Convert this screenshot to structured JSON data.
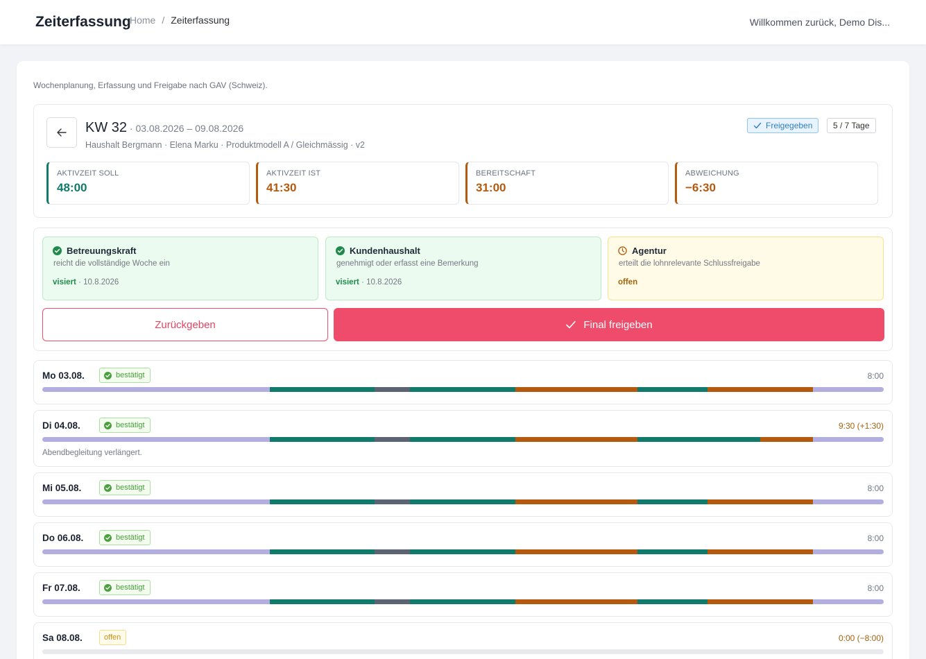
{
  "header": {
    "title": "Zeiterfassung",
    "breadcrumb": [
      "Home",
      "/",
      "Zeiterfassung"
    ],
    "welcome": "Willkommen zurück, Demo Dis..."
  },
  "subtitle": "Wochenplanung, Erfassung und Freigabe nach GAV (Schweiz).",
  "week": {
    "kw": "KW 32",
    "range": " · 03.08.2026 – 09.08.2026",
    "meta": "Haushalt Bergmann · Elena Marku · Produktmodell A / Gleichmässig · v2",
    "status_badge": "Freigegeben",
    "days_badge": "5 / 7 Tage"
  },
  "stats": [
    {
      "label": "AKTIVZEIT SOLL",
      "value": "48:00",
      "color": "#127a6a"
    },
    {
      "label": "AKTIVZEIT IST",
      "value": "41:30",
      "color": "#b45a0e"
    },
    {
      "label": "BEREITSCHAFT",
      "value": "31:00",
      "color": "#b45a0e"
    },
    {
      "label": "ABWEICHUNG",
      "value": "−6:30",
      "color": "#b45a0e"
    }
  ],
  "approvals": [
    {
      "title": "Betreuungskraft",
      "desc": "reicht die vollständige Woche ein",
      "status": "visiert",
      "date": " · 10.8.2026"
    },
    {
      "title": "Kundenhaushalt",
      "desc": "genehmigt oder erfasst eine Bemerkung",
      "status": "visiert",
      "date": " · 10.8.2026"
    },
    {
      "title": "Agentur",
      "desc": "erteilt die lohnrelevante Schlussfreigabe",
      "status": "offen",
      "date": ""
    }
  ],
  "actions": {
    "return_label": "Zurückgeben",
    "final_label": "Final freigeben"
  },
  "colors": {
    "accent": "#ef4b6a",
    "active": "#127a6a",
    "pause": "#5c6373",
    "standby": "#b45a0e",
    "rest": "#b3aee0"
  },
  "days": [
    {
      "label": "Mo 03.08.",
      "badge": "bestätigt",
      "total": "8:00",
      "note": ""
    },
    {
      "label": "Di 04.08.",
      "badge": "bestätigt",
      "total": "9:30 (+1:30)",
      "note": "Abendbegleitung verlängert."
    },
    {
      "label": "Mi 05.08.",
      "badge": "bestätigt",
      "total": "8:00",
      "note": ""
    },
    {
      "label": "Do 06.08.",
      "badge": "bestätigt",
      "total": "8:00",
      "note": ""
    },
    {
      "label": "Fr 07.08.",
      "badge": "bestätigt",
      "total": "8:00",
      "note": ""
    },
    {
      "label": "Sa 08.08.",
      "badge": "offen",
      "total": "0:00 (−8:00)",
      "note": ""
    }
  ]
}
